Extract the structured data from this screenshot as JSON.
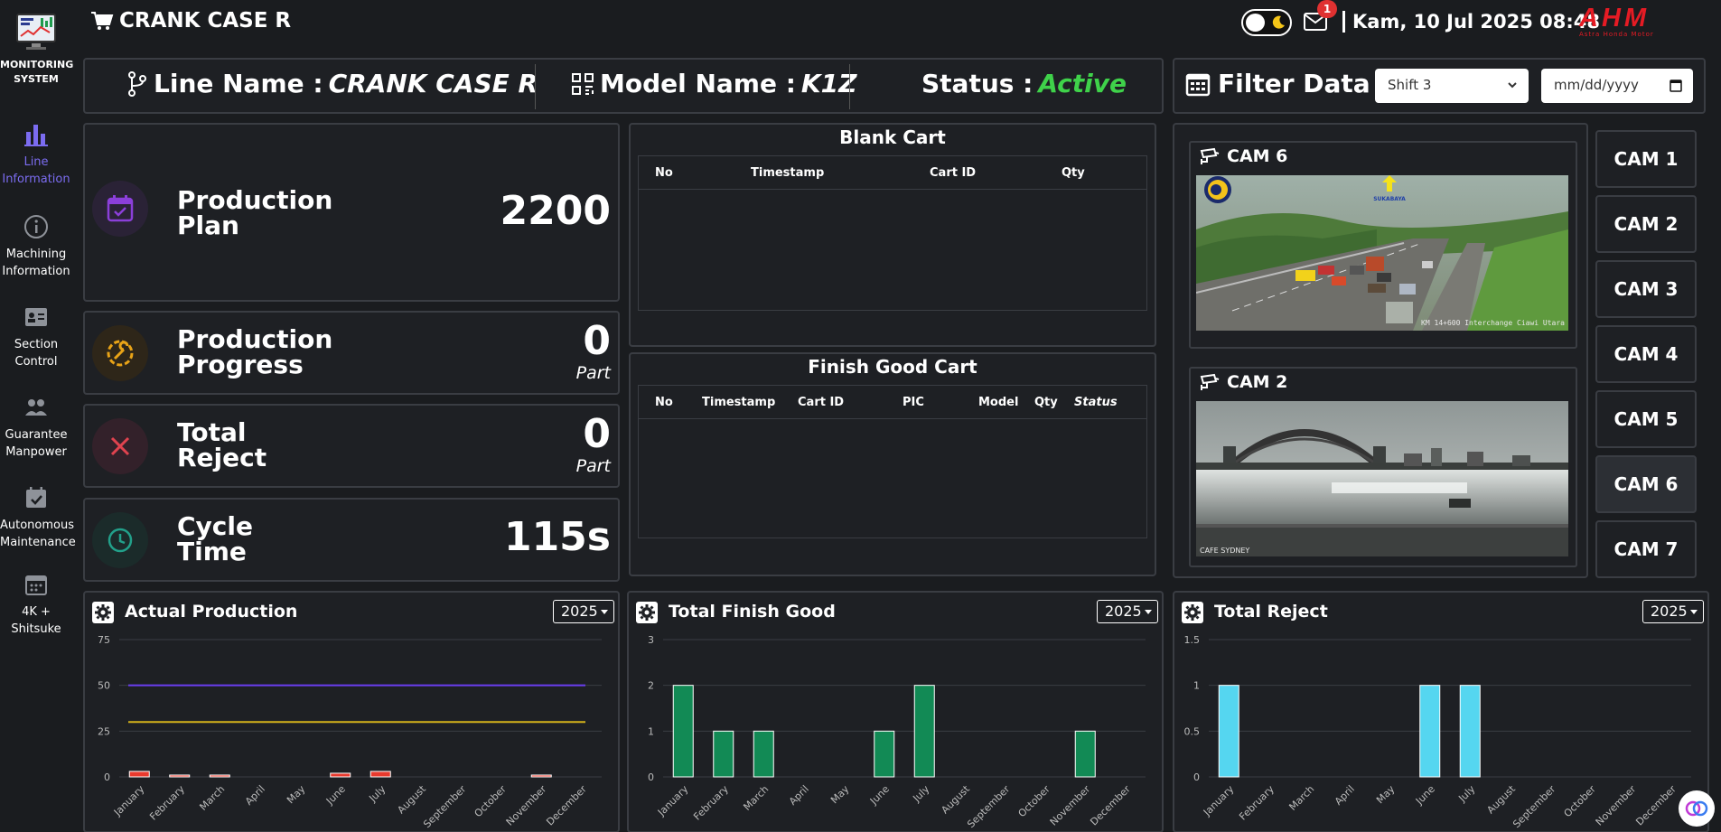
{
  "sidebar": {
    "brand_label": "MONITORING\nSYSTEM",
    "items": [
      {
        "label": "Line\nInformation",
        "icon": "bar-chart-icon",
        "active": true
      },
      {
        "label": "Machining\nInformation",
        "icon": "info-icon",
        "active": false
      },
      {
        "label": "Section\nControl",
        "icon": "id-card-icon",
        "active": false
      },
      {
        "label": "Guarantee\nManpower",
        "icon": "people-icon",
        "active": false
      },
      {
        "label": "Autonomous\nMaintenance",
        "icon": "calendar-check-icon",
        "active": false
      },
      {
        "label": "4K +\nShitsuke",
        "icon": "calendar-dots-icon",
        "active": false
      }
    ]
  },
  "header": {
    "title": "CRANK CASE R",
    "notification_count": "1",
    "datetime": "Kam, 10 Jul 2025 08:48",
    "logo_text": "AHM",
    "logo_sub": "Astra Honda Motor"
  },
  "info": {
    "line_label": "Line Name :",
    "line_value": "CRANK CASE R",
    "model_label": "Model Name :",
    "model_value": "K1Z",
    "status_label": "Status :",
    "status_value": "Active"
  },
  "filter": {
    "label": "Filter Data :",
    "shift_value": "Shift 3",
    "date_placeholder": "mm/dd/yyyy"
  },
  "stats": [
    {
      "label": "Production\nPlan",
      "value": "2200",
      "unit": "",
      "color": "#8b3fd9"
    },
    {
      "label": "Production\nProgress",
      "value": "0",
      "unit": "Part",
      "color": "#e8a317"
    },
    {
      "label": "Total\nReject",
      "value": "0",
      "unit": "Part",
      "color": "#e0434f"
    },
    {
      "label": "Cycle\nTime",
      "value": "115s",
      "unit": "",
      "color": "#22a08a"
    }
  ],
  "blank_cart": {
    "title": "Blank Cart",
    "columns": [
      "No",
      "Timestamp",
      "Cart ID",
      "Qty"
    ]
  },
  "finish_cart": {
    "title": "Finish Good Cart",
    "columns": [
      "No",
      "Timestamp",
      "Cart ID",
      "PIC",
      "Model",
      "Qty",
      "Status"
    ]
  },
  "cameras": {
    "panels": [
      {
        "title": "CAM 6",
        "caption": "KM 14+600 Interchange Ciawi Utara",
        "sign": "SUKABAYA"
      },
      {
        "title": "CAM 2",
        "caption": "CAFE SYDNEY"
      }
    ],
    "buttons": [
      "CAM 1",
      "CAM 2",
      "CAM 3",
      "CAM 4",
      "CAM 5",
      "CAM 6",
      "CAM 7"
    ],
    "active_button": "CAM 6"
  },
  "chart_data": [
    {
      "type": "bar",
      "title": "Actual Production",
      "year": "2025",
      "categories": [
        "January",
        "February",
        "March",
        "April",
        "May",
        "June",
        "July",
        "August",
        "September",
        "October",
        "November",
        "December"
      ],
      "series": [
        {
          "values": [
            3,
            1,
            1,
            0,
            0,
            2,
            3,
            0,
            0,
            0,
            1,
            0
          ],
          "color": "#e83a2e"
        }
      ],
      "reference_lines": [
        {
          "value": 50,
          "color": "#6a3ef0"
        },
        {
          "value": 30,
          "color": "#d4b21a"
        }
      ],
      "ylim": [
        0,
        75
      ],
      "yticks": [
        0,
        25,
        50,
        75
      ]
    },
    {
      "type": "bar",
      "title": "Total Finish Good",
      "year": "2025",
      "categories": [
        "January",
        "February",
        "March",
        "April",
        "May",
        "June",
        "July",
        "August",
        "September",
        "October",
        "November",
        "December"
      ],
      "series": [
        {
          "values": [
            2,
            1,
            1,
            0,
            0,
            1,
            2,
            0,
            0,
            0,
            1,
            0
          ],
          "color": "#128a55"
        }
      ],
      "ylim": [
        0,
        3
      ],
      "yticks": [
        0,
        1,
        2,
        3
      ]
    },
    {
      "type": "bar",
      "title": "Total Reject",
      "year": "2025",
      "categories": [
        "January",
        "February",
        "March",
        "April",
        "May",
        "June",
        "July",
        "August",
        "September",
        "October",
        "November",
        "December"
      ],
      "series": [
        {
          "values": [
            1,
            0,
            0,
            0,
            0,
            1,
            1,
            0,
            0,
            0,
            0,
            0
          ],
          "color": "#55d6f0"
        }
      ],
      "ylim": [
        0,
        1.5
      ],
      "yticks": [
        0,
        0.5,
        1,
        1.5
      ]
    }
  ]
}
